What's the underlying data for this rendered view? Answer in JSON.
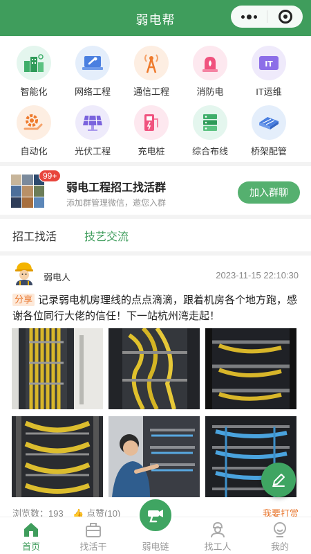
{
  "app": {
    "title": "弱电帮"
  },
  "categories": [
    {
      "label": "智能化",
      "icon": "smart-building-icon",
      "bg": "#e4f6ee"
    },
    {
      "label": "网络工程",
      "icon": "network-laptop-icon",
      "bg": "#e4eefb"
    },
    {
      "label": "通信工程",
      "icon": "signal-tower-icon",
      "bg": "#fdeee2"
    },
    {
      "label": "消防电",
      "icon": "fire-alarm-icon",
      "bg": "#fde8ef"
    },
    {
      "label": "IT运维",
      "icon": "it-icon",
      "bg": "#efeafb"
    },
    {
      "label": "自动化",
      "icon": "automation-gear-icon",
      "bg": "#fdeee2"
    },
    {
      "label": "光伏工程",
      "icon": "solar-panel-icon",
      "bg": "#eeebfb"
    },
    {
      "label": "充电桩",
      "icon": "charging-pile-icon",
      "bg": "#fde8ef"
    },
    {
      "label": "综合布线",
      "icon": "server-rack-icon",
      "bg": "#e4f6ee"
    },
    {
      "label": "桥架配管",
      "icon": "cable-tray-icon",
      "bg": "#e4eefb"
    }
  ],
  "group": {
    "badge": "99+",
    "title": "弱电工程招工找活群",
    "subtitle": "添加群管理微信，邀您入群",
    "join_label": "加入群聊"
  },
  "tabs": [
    {
      "label": "招工找活",
      "active": false
    },
    {
      "label": "技艺交流",
      "active": true
    }
  ],
  "post": {
    "author": "弱电人",
    "time": "2023-11-15 22:10:30",
    "tag": "分享",
    "text": "记录弱电机房理线的点点滴滴，跟着机房各个地方跑，感谢各位同行大佬的信任！下一站杭州湾走起！",
    "stats": {
      "views": "浏览数：193",
      "likes": "点赞(10)",
      "reward": "我要打赏"
    }
  },
  "tabbar": [
    {
      "label": "首页",
      "icon": "home-icon",
      "active": true
    },
    {
      "label": "找活干",
      "icon": "toolbox-icon",
      "active": false
    },
    {
      "label": "弱电链",
      "icon": "camera-chain-icon",
      "active": false
    },
    {
      "label": "找工人",
      "icon": "worker-icon",
      "active": false
    },
    {
      "label": "我的",
      "icon": "profile-icon",
      "active": false
    }
  ],
  "colors": {
    "brand": "#3f9d5c",
    "accent": "#e8742a",
    "badge": "#e8453c"
  }
}
